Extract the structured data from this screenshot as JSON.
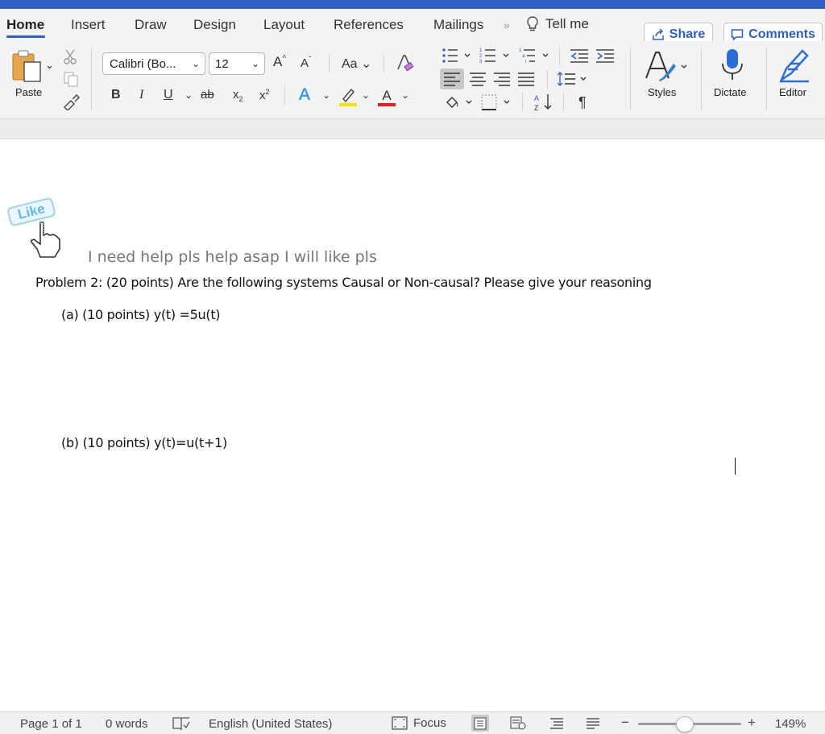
{
  "tabs": [
    "Home",
    "Insert",
    "Draw",
    "Design",
    "Layout",
    "References",
    "Mailings"
  ],
  "tell_me": "Tell me",
  "share_label": "Share",
  "comments_label": "Comments",
  "clipboard": {
    "paste_label": "Paste"
  },
  "font": {
    "name": "Calibri (Bo...",
    "size": "12",
    "change_case": "Aa"
  },
  "format_buttons": {
    "bold": "B",
    "italic": "I",
    "underline": "U",
    "strike": "ab",
    "subscript": "x",
    "superscript": "x"
  },
  "styles_label": "Styles",
  "dictate_label": "Dictate",
  "editor_label": "Editor",
  "document": {
    "like_badge": "Like",
    "help_text": "I need help pls help asap I will like pls",
    "problem": "Problem 2: (20 points)  Are the following systems Causal or Non-causal?  Please give your reasoning",
    "part_a": "(a)  (10 points)   y(t) =5u(t)",
    "part_b": "(b)  (10 points)   y(t)=u(t+1)"
  },
  "status": {
    "page": "Page 1 of 1",
    "words": "0 words",
    "language": "English (United States)",
    "focus": "Focus",
    "zoom": "149%",
    "zoom_level": 0.45
  },
  "colors": {
    "accent": "#2b5fc6",
    "highlight": "#f5e400",
    "font_color": "#e02020"
  }
}
